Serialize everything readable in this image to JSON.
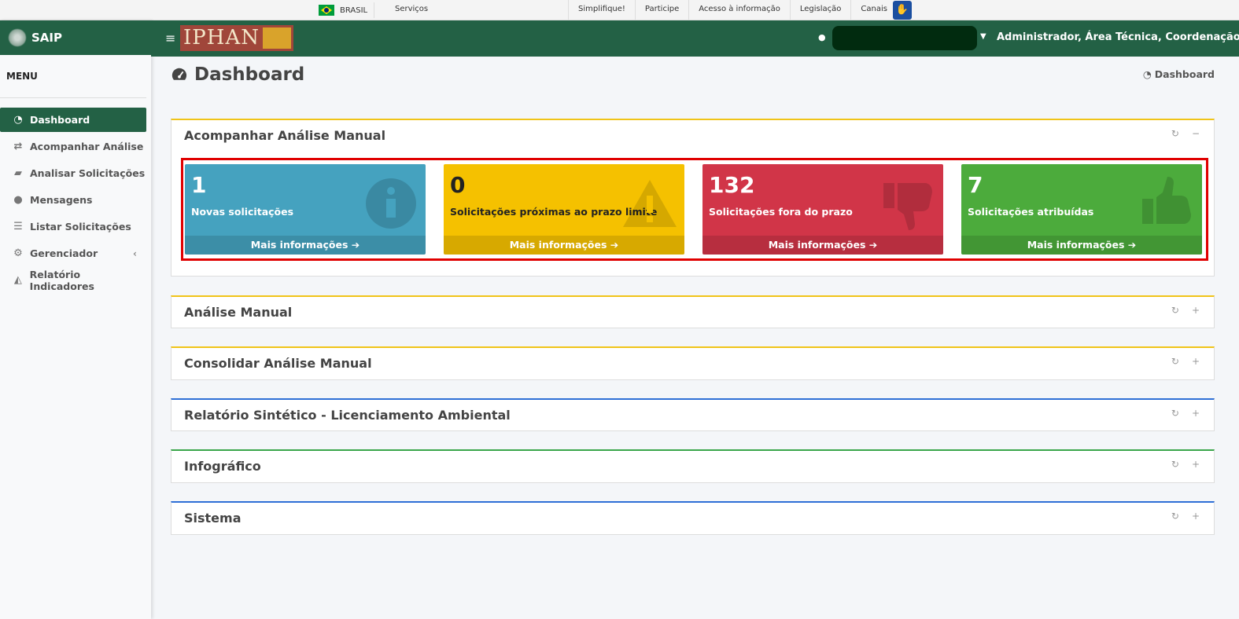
{
  "govbar": {
    "brasil": "BRASIL",
    "servicos": "Serviços",
    "links": [
      "Simplifique!",
      "Participe",
      "Acesso à informação",
      "Legislação",
      "Canais"
    ]
  },
  "sidebar": {
    "brand": "SAIP",
    "menu_title": "MENU",
    "items": [
      {
        "label": "Dashboard",
        "icon": "dashboard-icon"
      },
      {
        "label": "Acompanhar Análise",
        "icon": "exchange-icon"
      },
      {
        "label": "Analisar Solicitações",
        "icon": "book-icon"
      },
      {
        "label": "Mensagens",
        "icon": "comments-icon"
      },
      {
        "label": "Listar Solicitações",
        "icon": "list-icon"
      },
      {
        "label": "Gerenciador",
        "icon": "cogs-icon"
      },
      {
        "label": "Relatório Indicadores",
        "icon": "area-chart-icon"
      }
    ]
  },
  "header": {
    "logo_text": "IPHAN",
    "user": "Administrador, Área Técnica, Coordenação..."
  },
  "content": {
    "title": "Dashboard",
    "breadcrumb": "Dashboard"
  },
  "boxes": [
    {
      "title": "Acompanhar Análise Manual",
      "expanded": true
    },
    {
      "title": "Análise Manual",
      "expanded": false
    },
    {
      "title": "Consolidar Análise Manual",
      "expanded": false
    },
    {
      "title": "Relatório Sintético - Licenciamento Ambiental",
      "expanded": false
    },
    {
      "title": "Infográfico",
      "expanded": false
    },
    {
      "title": "Sistema",
      "expanded": false
    }
  ],
  "stats": [
    {
      "value": "1",
      "label": "Novas solicitações",
      "footer": "Mais informações",
      "color": "#45a2bf",
      "icon": "info-icon"
    },
    {
      "value": "0",
      "label": "Solicitações próximas ao prazo limite",
      "footer": "Mais informações",
      "color": "#f5c100",
      "icon": "warning-icon"
    },
    {
      "value": "132",
      "label": "Solicitações fora do prazo",
      "footer": "Mais informações",
      "color": "#d13548",
      "icon": "thumbs-down-icon"
    },
    {
      "value": "7",
      "label": "Solicitações atribuídas",
      "footer": "Mais informações",
      "color": "#4cab3c",
      "icon": "thumbs-up-icon"
    }
  ]
}
